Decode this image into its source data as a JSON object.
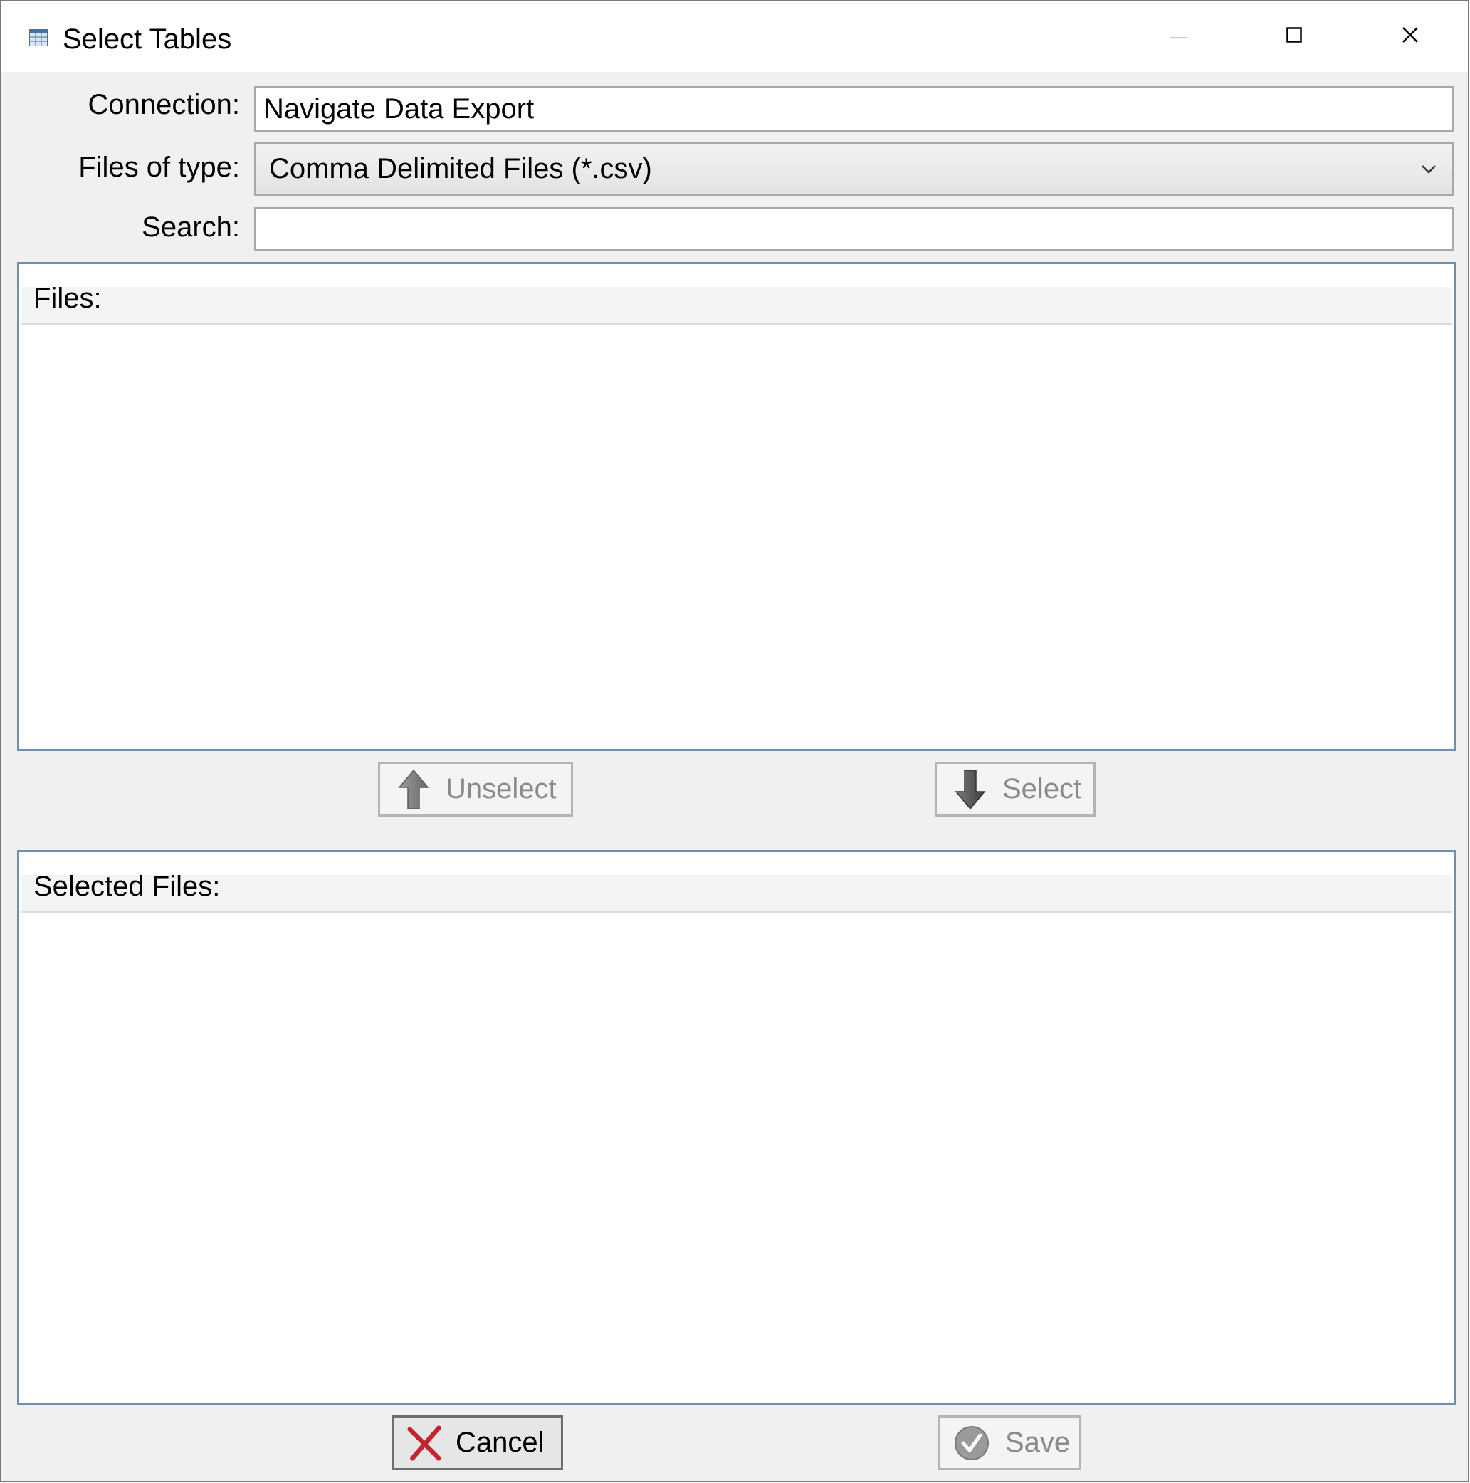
{
  "window": {
    "title": "Select Tables",
    "icon": "table-icon"
  },
  "titlebar_buttons": {
    "minimize": "minimize-icon",
    "maximize": "maximize-icon",
    "close": "close-icon"
  },
  "form": {
    "connection_label": "Connection:",
    "connection_value": "Navigate Data Export",
    "files_of_type_label": "Files of type:",
    "files_of_type_value": "Comma Delimited Files (*.csv)",
    "search_label": "Search:",
    "search_value": ""
  },
  "files_panel": {
    "label": "Files:",
    "items": []
  },
  "transfer_buttons": {
    "unselect_label": "Unselect",
    "select_label": "Select"
  },
  "selected_panel": {
    "label": "Selected Files:",
    "items": []
  },
  "footer": {
    "cancel_label": "Cancel",
    "save_label": "Save"
  },
  "colors": {
    "panel_border": "#6f8fb0",
    "cancel_x": "#c0262c",
    "disabled_text": "#8a8a8a"
  }
}
